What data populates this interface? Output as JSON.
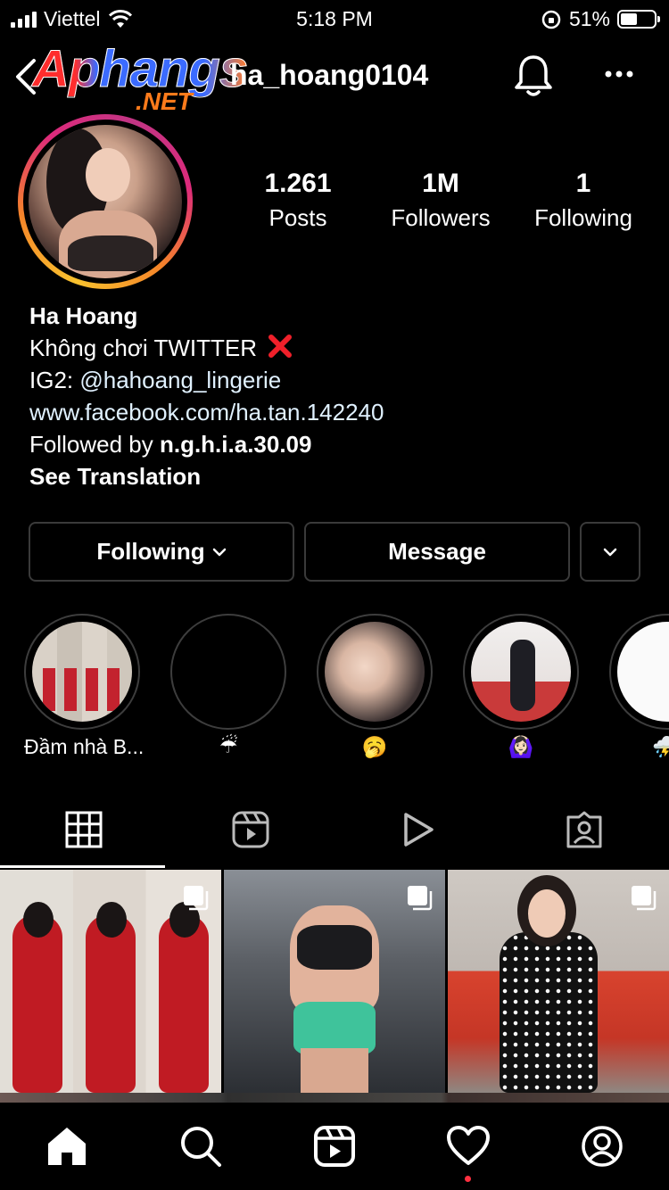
{
  "status_bar": {
    "carrier": "Viettel",
    "time": "5:18 PM",
    "battery": "51%",
    "battery_level": 0.51
  },
  "header": {
    "username": "ha_hoang0104",
    "watermark_line1": "Aphangs",
    "watermark_line2": ".NET"
  },
  "profile": {
    "stats": [
      {
        "value": "1.261",
        "label": "Posts"
      },
      {
        "value": "1M",
        "label": "Followers"
      },
      {
        "value": "1",
        "label": "Following"
      }
    ],
    "name": "Ha Hoang",
    "bio_line1": "Không chơi TWITTER",
    "bio_ig2_prefix": "IG2: ",
    "bio_ig2_mention": "@hahoang_lingerie",
    "website": "www.facebook.com/ha.tan.142240",
    "followed_by_prefix": "Followed by ",
    "followed_by_user": "n.g.h.i.a.30.09",
    "see_translation": "See Translation"
  },
  "buttons": {
    "following": "Following",
    "message": "Message"
  },
  "highlights": [
    {
      "caption": "Đầm nhà B..."
    },
    {
      "caption": "☔"
    },
    {
      "caption": "🥱"
    },
    {
      "caption": "🙆🏻‍♀️"
    },
    {
      "caption": "⛈️"
    }
  ],
  "tabs": [
    "grid",
    "reels",
    "videos",
    "tagged"
  ],
  "colors": {
    "background": "#000000",
    "link": "#e0f1ff",
    "notification_dot": "#ff3040",
    "button_border": "#3a3a3a"
  }
}
